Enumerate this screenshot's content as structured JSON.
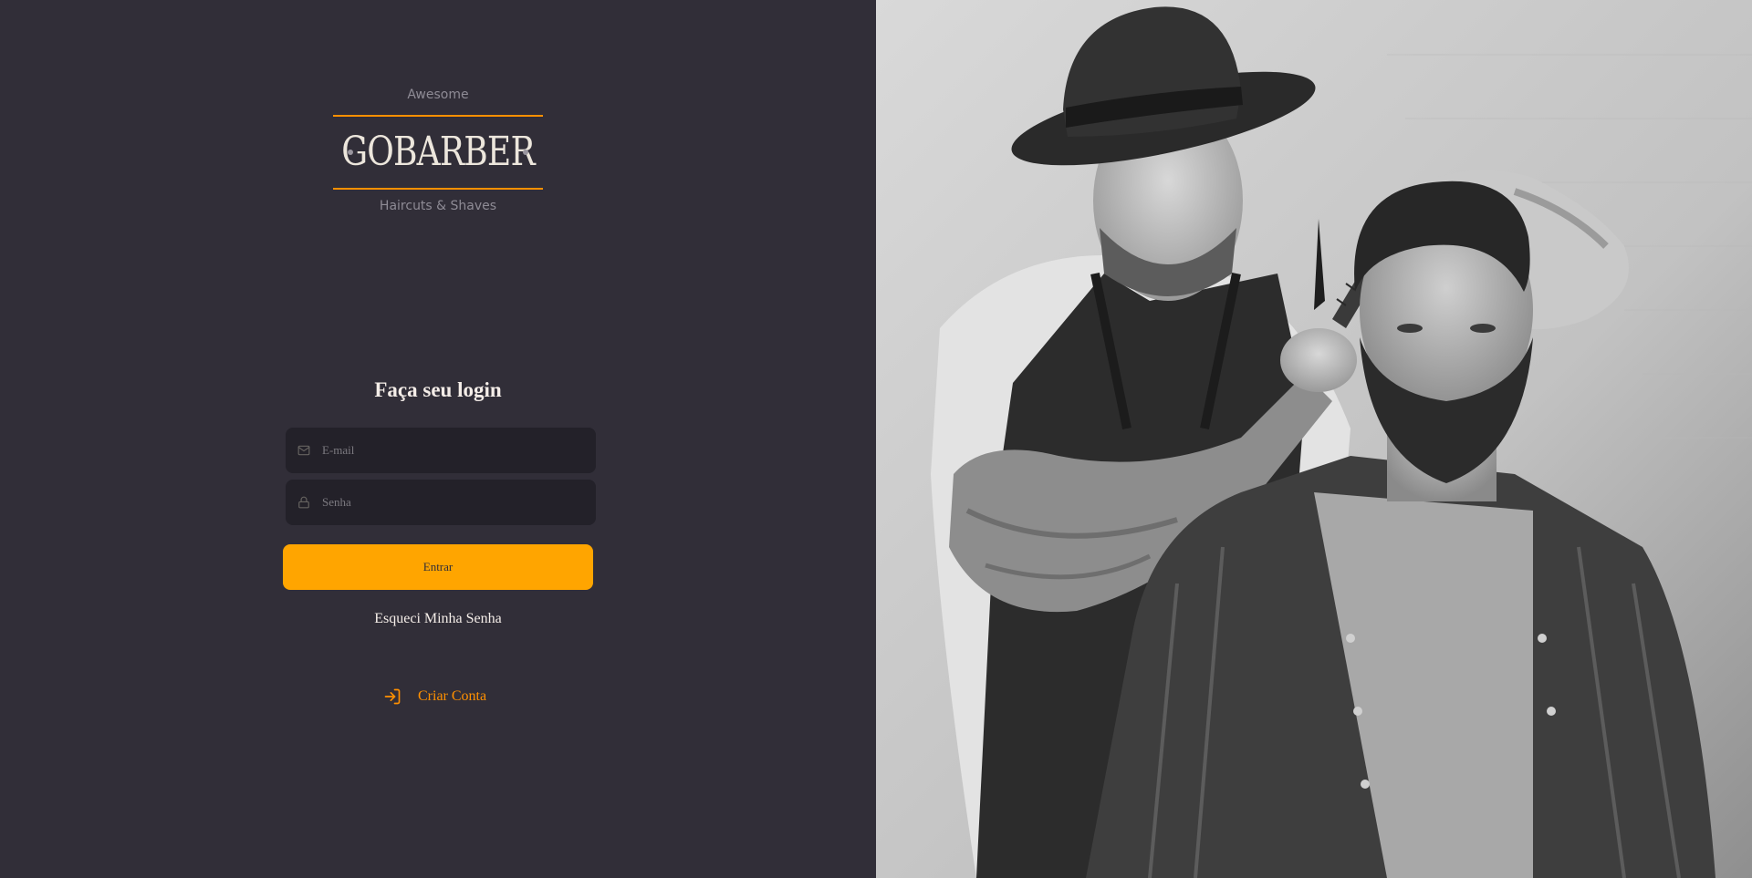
{
  "logo": {
    "top_text": "Awesome",
    "wordmark": "GOBARBER",
    "bottom_text": "Haircuts & Shaves",
    "accent_color": "#ff9000"
  },
  "login": {
    "title": "Faça seu login",
    "email": {
      "placeholder": "E-mail",
      "icon": "mail-icon"
    },
    "password": {
      "placeholder": "Senha",
      "icon": "lock-icon"
    },
    "submit_label": "Entrar",
    "forgot_label": "Esqueci Minha Senha"
  },
  "signup": {
    "label": "Criar Conta",
    "icon": "log-in-icon"
  },
  "hero": {
    "alt": "Barber cutting a customer's hair (black and white photo)"
  },
  "colors": {
    "background": "#312e38",
    "input_bg": "#232129",
    "button": "#ffa500",
    "text": "#f4ede8",
    "accent": "#ff9000"
  }
}
